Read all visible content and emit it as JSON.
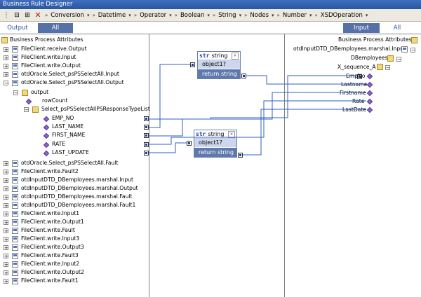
{
  "title_bar": {
    "text": "Business Rule Designer"
  },
  "toolbar": {
    "menus": [
      "Conversion",
      "Datetime",
      "Operator",
      "Boolean",
      "String",
      "Nodes",
      "Number",
      "XSDOperation"
    ]
  },
  "left_tabs": {
    "output": "Output",
    "all": "All"
  },
  "right_tabs": {
    "input": "Input",
    "all": "All"
  },
  "left_tree": {
    "root_label": "Business Process Attributes",
    "items": [
      "FileClient.receive.Output",
      "FileClient.write.Input",
      "FileClient.write.Output",
      "otdOracle.Select_psPSSelectAll.Input",
      "otdOracle.Select_psPSSelectAll.Output",
      "output",
      "rowCount",
      "Select_psPSSelectAllPSResponseTypeList",
      "EMP_NO",
      "LAST_NAME",
      "FIRST_NAME",
      "RATE",
      "LAST_UPDATE",
      "otdOracle.Select_psPSSelectAll.Fault",
      "FileClient.write.Fault2",
      "otdInputDTD_DBemployees.marshal.Input",
      "otdInputDTD_DBemployees.marshal.Output",
      "otdInputDTD_DBemployees.marshal.Fault",
      "otdInputDTD_DBemployees.marshal.Fault1",
      "FileClient.write.Input1",
      "FileClient.write.Output1",
      "FileClient.write.Fault",
      "FileClient.write.Input3",
      "FileClient.write.Output3",
      "FileClient.write.Fault3",
      "FileClient.write.Input2",
      "FileClient.write.Output2",
      "FileClient.write.Fault1"
    ]
  },
  "right_tree": {
    "root_label": "Business Process Attributes",
    "items": [
      "otdInputDTD_DBemployees.marshal.Input",
      "DBemployees",
      "X_sequence_A",
      "EmpNo",
      "Lastname",
      "Firstname",
      "Rate",
      "LastDate"
    ]
  },
  "methods": [
    {
      "type_tag": "str",
      "name": "string",
      "param": "object1?",
      "ret": "return string"
    },
    {
      "type_tag": "str",
      "name": "string",
      "param": "object1?",
      "ret": "return string"
    }
  ],
  "colors": {
    "link": "#2f5fc6",
    "title_bar": "#2a569f",
    "active_tab": "#5671a8"
  },
  "icons": {
    "toolbar": [
      "grip-icon",
      "collapse-all-icon",
      "expand-all-icon",
      "delete-icon"
    ],
    "expanders": "plus-minus-icon",
    "node": "structure-node-icon",
    "leaf": "field-diamond-icon"
  }
}
